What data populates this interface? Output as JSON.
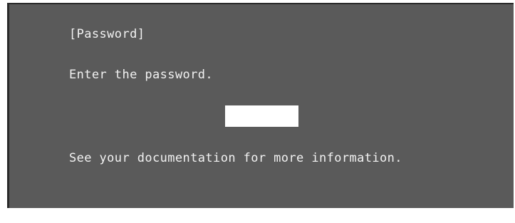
{
  "dialog": {
    "title": "[Password]",
    "prompt": "Enter the password.",
    "password_value": "",
    "help_text": "See your documentation for more information."
  },
  "colors": {
    "panel_background": "#5a5a5a",
    "text": "#f2f2f2",
    "input_background": "#ffffff"
  }
}
